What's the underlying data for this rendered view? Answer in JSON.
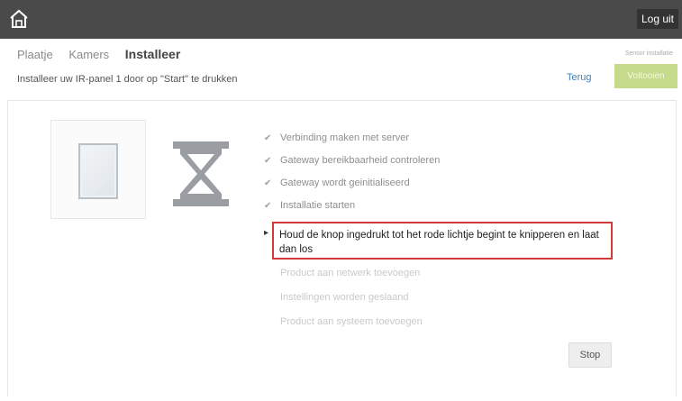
{
  "header": {
    "home_icon": "home-icon",
    "logout_label": "Log uit"
  },
  "breadcrumb": {
    "items": [
      "Plaatje",
      "Kamers",
      "Installeer"
    ]
  },
  "sub_label": "Sensor installatie",
  "instruction": "Installeer uw IR-panel 1 door op \"Start\" te drukken",
  "actions": {
    "back_label": "Terug",
    "finish_label": "Voltooien"
  },
  "steps": {
    "done": [
      "Verbinding maken met server",
      "Gateway bereikbaarheid controleren",
      "Gateway wordt geinitialiseerd",
      "Installatie starten"
    ],
    "current": "Houd de knop ingedrukt tot het rode lichtje begint te knipperen en laat dan los",
    "pending": [
      "Product aan netwerk toevoegen",
      "Instellingen worden geslaand",
      "Product aan systeem toevoegen"
    ]
  },
  "stop_label": "Stop",
  "colors": {
    "topbar": "#4a4a4a",
    "highlight_border": "#d23a3a",
    "finish_button": "#c5da8a",
    "link": "#3b7fc4"
  }
}
